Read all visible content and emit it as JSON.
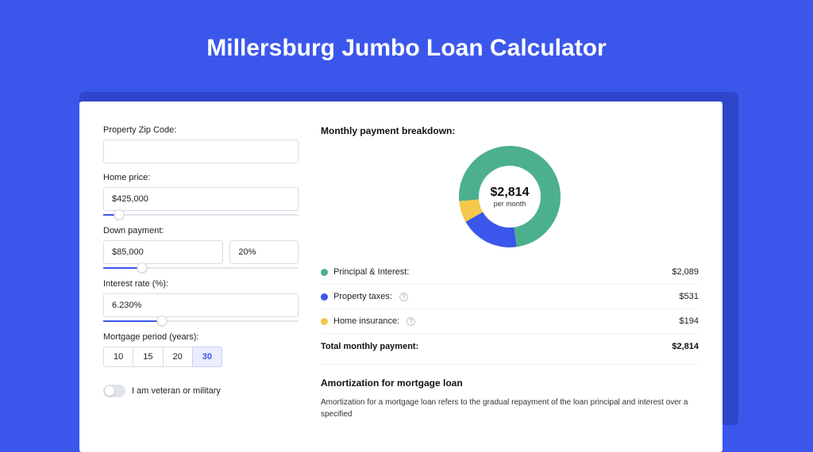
{
  "title": "Millersburg Jumbo Loan Calculator",
  "colors": {
    "principal": "#4cb08e",
    "taxes": "#3b57eb",
    "insurance": "#f2c94c"
  },
  "chart_data": {
    "type": "pie",
    "title": "Monthly payment breakdown:",
    "center_value": "$2,814",
    "center_sub": "per month",
    "series": [
      {
        "name": "Principal & Interest",
        "value": 2089
      },
      {
        "name": "Property taxes",
        "value": 531
      },
      {
        "name": "Home insurance",
        "value": 194
      }
    ],
    "total": 2814
  },
  "inputs": {
    "zip_label": "Property Zip Code:",
    "zip_value": "",
    "price_label": "Home price:",
    "price_value": "$425,000",
    "price_slider_pct": 8,
    "down_label": "Down payment:",
    "down_value": "$85,000",
    "down_pct_value": "20%",
    "down_slider_pct": 20,
    "rate_label": "Interest rate (%):",
    "rate_value": "6.230%",
    "rate_slider_pct": 30,
    "period_label": "Mortgage period (years):",
    "period_options": [
      "10",
      "15",
      "20",
      "30"
    ],
    "period_selected": "30",
    "veteran_label": "I am veteran or military"
  },
  "breakdown": {
    "header": "Monthly payment breakdown:",
    "center_amount": "$2,814",
    "center_sub": "per month",
    "rows": [
      {
        "label": "Principal & Interest:",
        "tooltip": false,
        "value": "$2,089",
        "color": "c-green"
      },
      {
        "label": "Property taxes:",
        "tooltip": true,
        "value": "$531",
        "color": "c-blue"
      },
      {
        "label": "Home insurance:",
        "tooltip": true,
        "value": "$194",
        "color": "c-yellow"
      }
    ],
    "total_label": "Total monthly payment:",
    "total_value": "$2,814"
  },
  "amortization": {
    "heading": "Amortization for mortgage loan",
    "body": "Amortization for a mortgage loan refers to the gradual repayment of the loan principal and interest over a specified"
  }
}
